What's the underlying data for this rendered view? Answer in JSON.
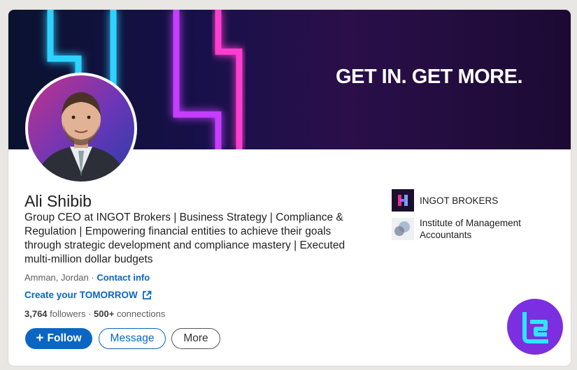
{
  "banner": {
    "tagline": "GET IN. GET MORE."
  },
  "profile": {
    "name": "Ali Shibib",
    "headline": "Group CEO at INGOT Brokers | Business Strategy | Compliance & Regulation | Empowering financial entities to achieve their goals through strategic development and compliance mastery | Executed multi-million dollar budgets",
    "location": "Amman, Jordan",
    "separator": " · ",
    "contact_label": "Contact info",
    "website_label": "Create your TOMORROW",
    "followers": "3,764",
    "followers_label": " followers",
    "stats_separator": " · ",
    "connections": "500+",
    "connections_label": " connections"
  },
  "actions": {
    "follow": "Follow",
    "follow_prefix": "+",
    "message": "Message",
    "more": "More"
  },
  "organizations": [
    {
      "name": "INGOT BROKERS",
      "icon": "ingot-logo"
    },
    {
      "name": "Institute of Management Accountants",
      "icon": "ima-logo"
    }
  ],
  "colors": {
    "accent": "#0a66c2",
    "watermark": "#7b2fe0"
  }
}
